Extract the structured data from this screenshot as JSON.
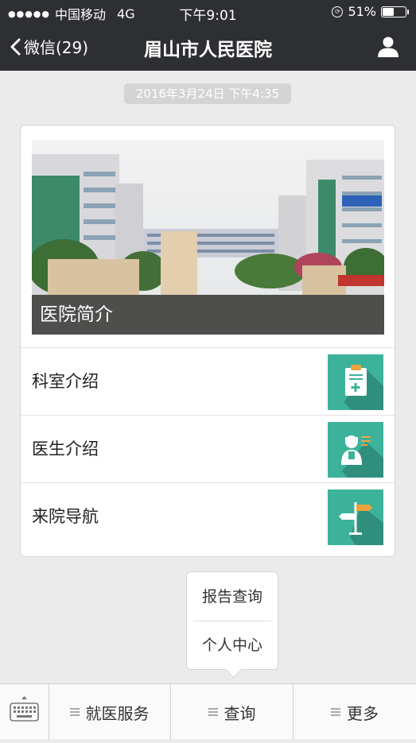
{
  "status_bar": {
    "carrier": "中国移动",
    "network": "4G",
    "time": "下午9:01",
    "battery_percent": "51%",
    "battery_level": 0.51
  },
  "nav": {
    "back_label": "微信(29)",
    "title": "眉山市人民医院"
  },
  "timestamp": "2016年3月24日 下午4:35",
  "card": {
    "hero_caption": "医院简介",
    "items": [
      {
        "label": "科室介绍",
        "icon": "clipboard-medical-icon"
      },
      {
        "label": "医生介绍",
        "icon": "doctor-icon"
      },
      {
        "label": "来院导航",
        "icon": "signpost-icon"
      }
    ]
  },
  "popup_menu": {
    "items": [
      "报告查询",
      "个人中心"
    ]
  },
  "menu_bar": {
    "keyboard_icon": "keyboard-icon",
    "tabs": [
      "就医服务",
      "查询",
      "更多"
    ]
  },
  "colors": {
    "bar_dark": "#2e2f33",
    "thumb_teal": "#3db29b",
    "background": "#ebebeb"
  }
}
